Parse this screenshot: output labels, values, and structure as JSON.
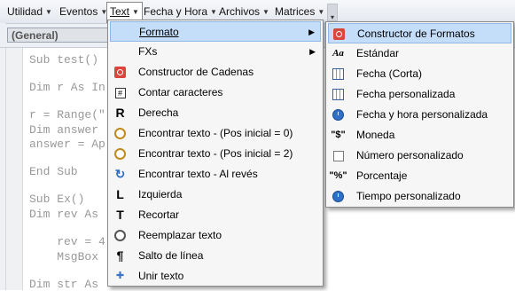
{
  "menubar": {
    "items": [
      {
        "label": "Utilidad"
      },
      {
        "label": "Eventos"
      },
      {
        "label": "Text"
      },
      {
        "label": "Fecha y Hora"
      },
      {
        "label": "Archivos"
      },
      {
        "label": "Matrices"
      }
    ]
  },
  "general_select": "(General)",
  "code_lines": [
    "Sub test()",
    "",
    "Dim r As In",
    "",
    "r = Range(\"",
    "Dim answer",
    "answer = Ap",
    "",
    "End Sub",
    "",
    "Sub Ex()",
    "Dim rev As",
    "",
    "    rev = 4",
    "    MsgBox",
    "",
    "Dim str As"
  ],
  "text_menu": {
    "items": [
      {
        "label": "Formato",
        "icon": "none",
        "submenu": true
      },
      {
        "label": "FXs",
        "icon": "none",
        "submenu": true
      },
      {
        "label": "Constructor de Cadenas",
        "icon": "red-gear-icon"
      },
      {
        "label": "Contar caracteres",
        "icon": "count-icon"
      },
      {
        "label": "Derecha",
        "icon": "letter-r-icon",
        "glyph": "R"
      },
      {
        "label": "Encontrar texto - (Pos inicial = 0)",
        "icon": "magnifier-icon"
      },
      {
        "label": "Encontrar texto - (Pos inicial = 2)",
        "icon": "magnifier-icon"
      },
      {
        "label": "Encontrar texto - Al revés",
        "icon": "reverse-arrow-icon",
        "glyph": "↻"
      },
      {
        "label": "Izquierda",
        "icon": "letter-l-icon",
        "glyph": "L"
      },
      {
        "label": "Recortar",
        "icon": "letter-t-icon",
        "glyph": "T"
      },
      {
        "label": "Reemplazar texto",
        "icon": "replace-icon"
      },
      {
        "label": "Salto de línea",
        "icon": "pilcrow-icon",
        "glyph": "¶"
      },
      {
        "label": "Unir texto",
        "icon": "plus-icon",
        "glyph": "✚"
      }
    ]
  },
  "formato_submenu": {
    "items": [
      {
        "label": "Constructor de Formatos",
        "icon": "red-gear-icon"
      },
      {
        "label": "Estándar",
        "icon": "font-aa-icon",
        "glyph": "Aa"
      },
      {
        "label": "Fecha (Corta)",
        "icon": "calendar-icon"
      },
      {
        "label": "Fecha personalizada",
        "icon": "calendar-icon"
      },
      {
        "label": "Fecha y hora personalizada",
        "icon": "clock-icon"
      },
      {
        "label": "Moneda",
        "icon": "currency-icon",
        "glyph": "\"$\""
      },
      {
        "label": "Número personalizado",
        "icon": "number-icon"
      },
      {
        "label": "Porcentaje",
        "icon": "percent-icon",
        "glyph": "\"%\""
      },
      {
        "label": "Tiempo personalizado",
        "icon": "clock-icon"
      }
    ]
  },
  "colors": {
    "highlight": "#c4defa",
    "menubar_bg": "#e4e8ee"
  }
}
